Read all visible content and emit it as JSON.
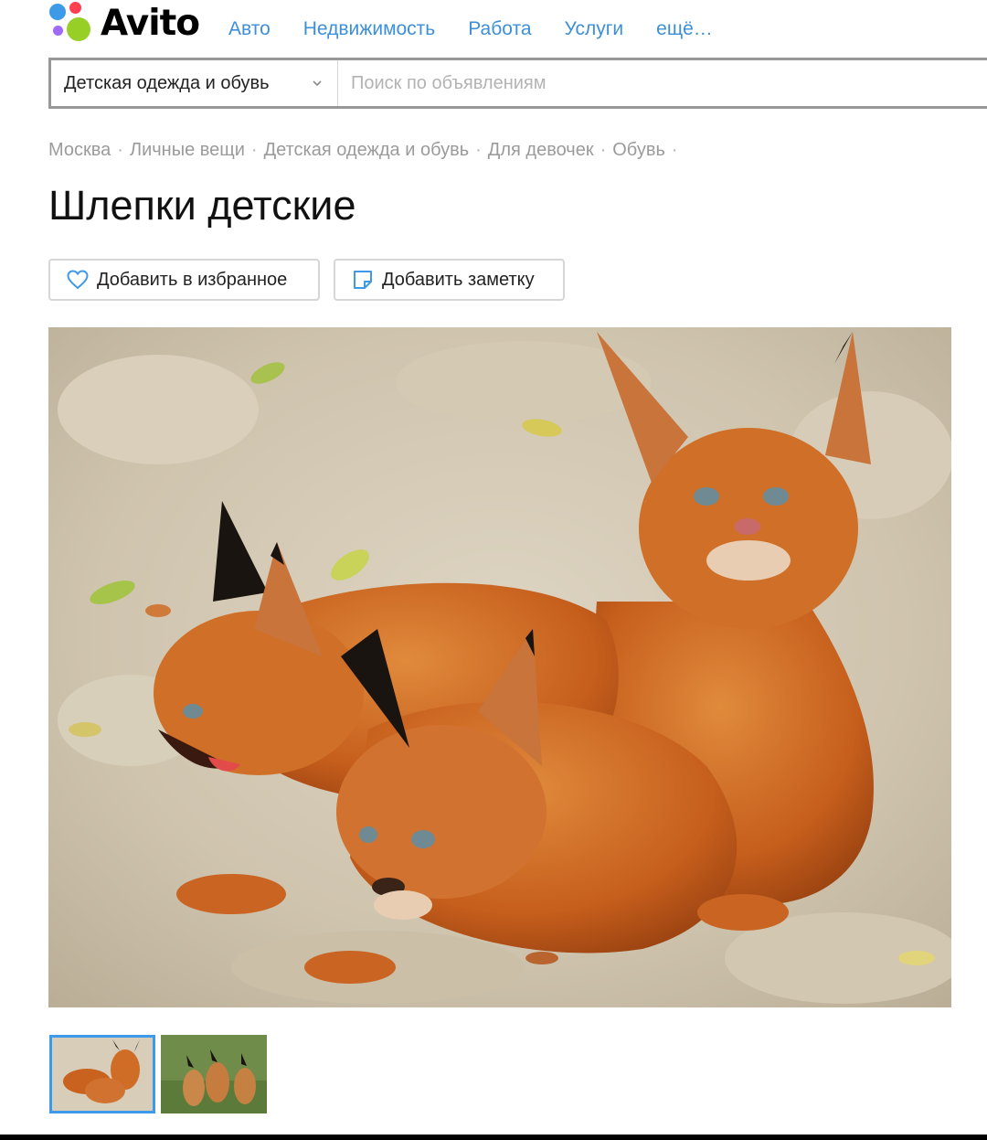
{
  "header": {
    "logo_text": "Avito",
    "logo_dot_colors": [
      "#3d9ae8",
      "#ff4053",
      "#97cf26",
      "#a169f7"
    ],
    "nav": [
      "Авто",
      "Недвижимость",
      "Работа",
      "Услуги",
      "ещё…"
    ]
  },
  "search": {
    "category": "Детская одежда и обувь",
    "placeholder": "Поиск по объявлениям"
  },
  "breadcrumb": [
    "Москва",
    "Личные вещи",
    "Детская одежда и обувь",
    "Для девочек",
    "Обувь"
  ],
  "listing": {
    "title": "Шлепки детские",
    "favorite_label": "Добавить в избранное",
    "note_label": "Добавить заметку",
    "accent_color": "#3d9ae8"
  },
  "gallery": {
    "main_image": "three caracal kittens on sand",
    "thumbnails": [
      "caracal kittens on sand",
      "caracal kittens on grass"
    ],
    "selected_index": 0
  }
}
